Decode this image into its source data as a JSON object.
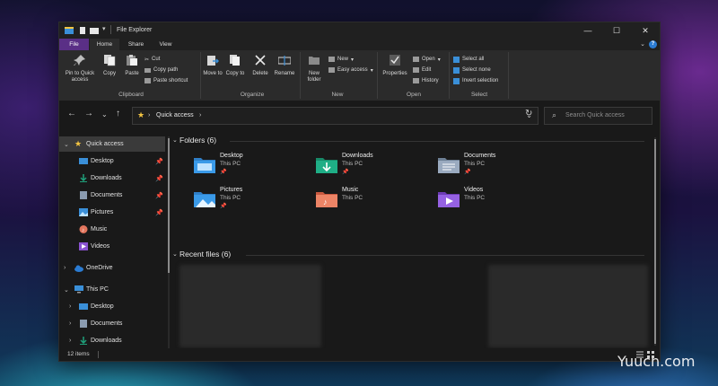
{
  "window": {
    "title": "File Explorer"
  },
  "tabs": [
    {
      "label": "File"
    },
    {
      "label": "Home"
    },
    {
      "label": "Share"
    },
    {
      "label": "View"
    }
  ],
  "ribbon": {
    "clipboard": {
      "label": "Clipboard",
      "pin": "Pin to Quick access",
      "copy": "Copy",
      "paste": "Paste",
      "cut": "Cut",
      "copy_path": "Copy path",
      "paste_shortcut": "Paste shortcut"
    },
    "organize": {
      "label": "Organize",
      "move_to": "Move to",
      "copy_to": "Copy to",
      "delete": "Delete",
      "rename": "Rename"
    },
    "new": {
      "label": "New",
      "new_folder": "New folder",
      "new_item": "New",
      "easy_access": "Easy access"
    },
    "open": {
      "label": "Open",
      "properties": "Properties",
      "open": "Open",
      "edit": "Edit",
      "history": "History"
    },
    "select": {
      "label": "Select",
      "select_all": "Select all",
      "select_none": "Select none",
      "invert": "Invert selection"
    }
  },
  "address": {
    "path": "Quick access"
  },
  "search": {
    "placeholder": "Search Quick access"
  },
  "nav": [
    {
      "label": "Quick access",
      "icon": "star-icon"
    },
    {
      "label": "Desktop",
      "icon": "desktop-folder-icon"
    },
    {
      "label": "Downloads",
      "icon": "downloads-folder-icon"
    },
    {
      "label": "Documents",
      "icon": "documents-folder-icon"
    },
    {
      "label": "Pictures",
      "icon": "pictures-folder-icon"
    },
    {
      "label": "Music",
      "icon": "music-folder-icon"
    },
    {
      "label": "Videos",
      "icon": "videos-folder-icon"
    },
    {
      "label": "OneDrive",
      "icon": "cloud-icon"
    },
    {
      "label": "This PC",
      "icon": "monitor-icon"
    },
    {
      "label": "Desktop",
      "icon": "desktop-folder-icon"
    },
    {
      "label": "Documents",
      "icon": "documents-folder-icon"
    },
    {
      "label": "Downloads",
      "icon": "downloads-folder-icon"
    }
  ],
  "folders_header": "Folders (6)",
  "recent_header": "Recent files (6)",
  "folders": [
    {
      "name": "Desktop",
      "location": "This PC",
      "pinned": "📌"
    },
    {
      "name": "Downloads",
      "location": "This PC",
      "pinned": "📌"
    },
    {
      "name": "Documents",
      "location": "This PC",
      "pinned": "📌"
    },
    {
      "name": "Pictures",
      "location": "This PC",
      "pinned": "📌"
    },
    {
      "name": "Music",
      "location": "This PC",
      "pinned": ""
    },
    {
      "name": "Videos",
      "location": "This PC",
      "pinned": ""
    }
  ],
  "status": {
    "item_count": "12 items"
  },
  "watermark": "Yuucn.com",
  "colors": {
    "accent_file_tab": "#5a2f86",
    "folder_blue": "#3a8fd8",
    "folder_green": "#1f9f7a",
    "folder_grey": "#8a9bb0",
    "folder_orange": "#e2755d",
    "folder_purple": "#8a52d1"
  }
}
